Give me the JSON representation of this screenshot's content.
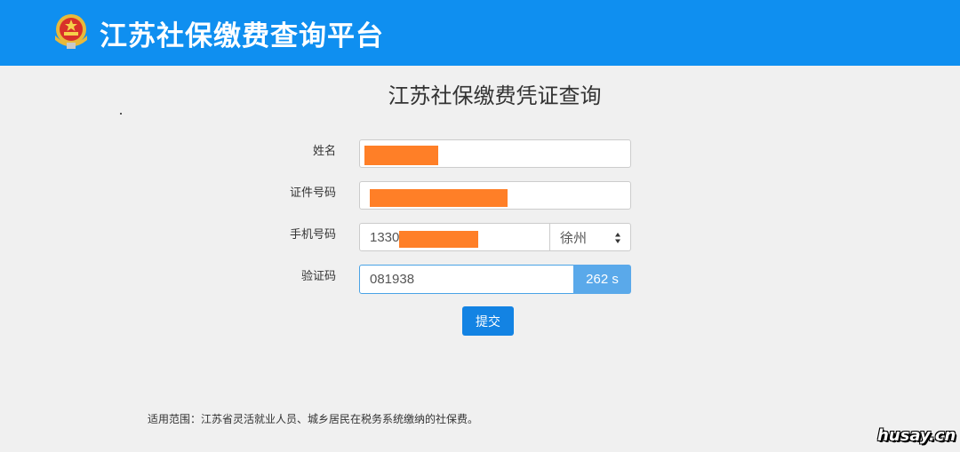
{
  "header": {
    "title": "江苏社保缴费查询平台",
    "emblem_icon": "national-emblem-icon",
    "background_color": "#0f8ff0"
  },
  "page": {
    "title": "江苏社保缴费凭证查询"
  },
  "form": {
    "name_label": "姓名",
    "id_label": "证件号码",
    "phone_label": "手机号码",
    "phone_value": "1330",
    "city_selected": "徐州",
    "code_label": "验证码",
    "code_value": "081938",
    "countdown": "262 s",
    "submit_label": "提交",
    "redaction_color": "#ff7f27"
  },
  "footer": {
    "scope_text": "适用范围：江苏省灵活就业人员、城乡居民在税务系统缴纳的社保费。"
  },
  "watermark": "husay.cn"
}
